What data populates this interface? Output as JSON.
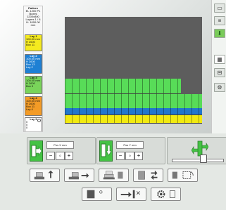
{
  "left_panel": {
    "title": "Pattern",
    "lines": [
      "EL 1200 P1",
      "Boxes 1200x800",
      "Layers 1 / 8",
      "H: 1000.00 mm"
    ],
    "layers": [
      {
        "title": "Lay 1",
        "lines": [
          "100.00 mm",
          "H 2600",
          "Box 11"
        ]
      },
      {
        "title": "Lay 2",
        "lines": [
          "100.00 mm",
          "H 2600",
          "Box 13",
          "Lay 2"
        ]
      },
      {
        "title": "Lay 3",
        "lines": [
          "100.00 mm",
          "H 2600",
          "Box 9"
        ]
      },
      {
        "title": "Lay 4",
        "lines": [
          "100.00 mm",
          "H 2600",
          "Box 11",
          "Lay 4"
        ]
      },
      {
        "title": "Lay 5",
        "lines": [
          "0",
          "0",
          "0"
        ]
      }
    ]
  },
  "canvas": {
    "layers": [
      {
        "color": "#f39b1d",
        "kind": "orange"
      },
      {
        "color": "#58dc58",
        "kind": "green"
      },
      {
        "color": "#2277cc",
        "kind": "blue"
      },
      {
        "color": "#f1ea11",
        "kind": "yellow"
      }
    ]
  },
  "right_sidebar": {
    "items": [
      {
        "icon": "pallet-icon"
      },
      {
        "icon": "layers-icon"
      },
      {
        "icon": "down-arrow-icon"
      },
      {
        "icon": "grid-icon"
      },
      {
        "icon": "save-icon"
      },
      {
        "icon": "settings-icon"
      }
    ]
  },
  "control_panels": {
    "panel1": {
      "label": "Pos X mm",
      "value": "0"
    },
    "panel2": {
      "label": "Pos Y mm",
      "value": "0"
    }
  },
  "toolbar": {
    "row1": [
      "lift-icon",
      "push-icon",
      "stack-icon",
      "turn-icon",
      "rotate-icon"
    ],
    "row2": [
      "pallet-icon",
      "transfer-icon",
      "gear-icon"
    ]
  }
}
